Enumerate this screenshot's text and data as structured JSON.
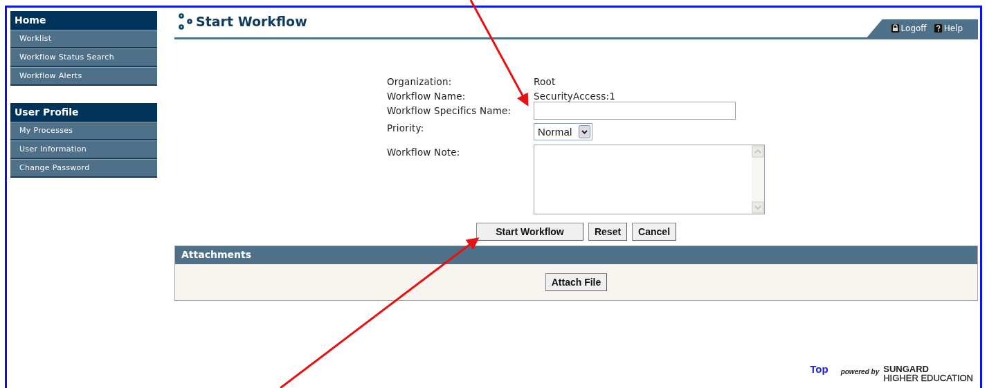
{
  "sidebar": {
    "sections": [
      {
        "title": "Home",
        "items": [
          "Worklist",
          "Workflow Status Search",
          "Workflow Alerts"
        ]
      },
      {
        "title": "User Profile",
        "items": [
          "My Processes",
          "User Information",
          "Change Password"
        ]
      }
    ]
  },
  "page": {
    "title": "Start Workflow",
    "header_links": [
      {
        "label": "Logoff",
        "kind": "logoff"
      },
      {
        "label": "Help",
        "kind": "help"
      }
    ]
  },
  "form": {
    "fields": [
      {
        "label": "Organization:",
        "kind": "text",
        "value": "Root"
      },
      {
        "label": "Workflow Name:",
        "kind": "text",
        "value": "SecurityAccess:1"
      },
      {
        "label": "Workflow Specifics Name:",
        "kind": "input"
      },
      {
        "label": "Priority:",
        "kind": "select",
        "value": "Normal"
      },
      {
        "label": "Workflow Note:",
        "kind": "textarea"
      }
    ],
    "buttons": [
      "Start Workflow",
      "Reset",
      "Cancel"
    ]
  },
  "attachments": {
    "title": "Attachments",
    "button": "Attach File"
  },
  "footer": {
    "top_link": "Top",
    "powered_by": "powered by",
    "brand": "SUNGARD",
    "brand_sub": "HIGHER EDUCATION"
  }
}
